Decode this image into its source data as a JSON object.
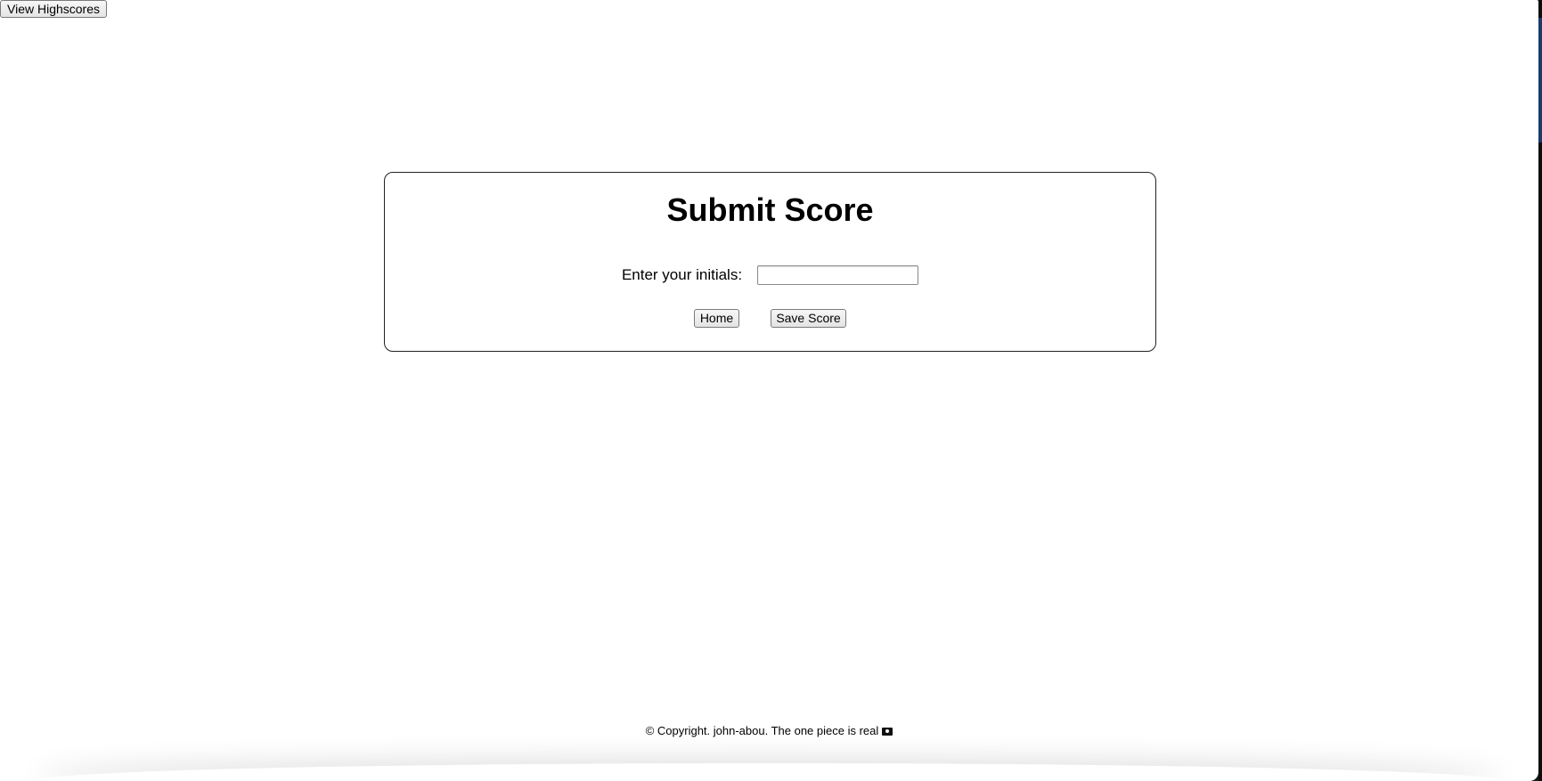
{
  "header": {
    "highscores_label": "View Highscores"
  },
  "card": {
    "title": "Submit Score",
    "initials_label": "Enter your initials:",
    "initials_value": "",
    "home_label": "Home",
    "save_label": "Save Score"
  },
  "footer": {
    "text": "© Copyright. john-abou. The one piece is real",
    "icon": "pirate-flag-icon"
  }
}
